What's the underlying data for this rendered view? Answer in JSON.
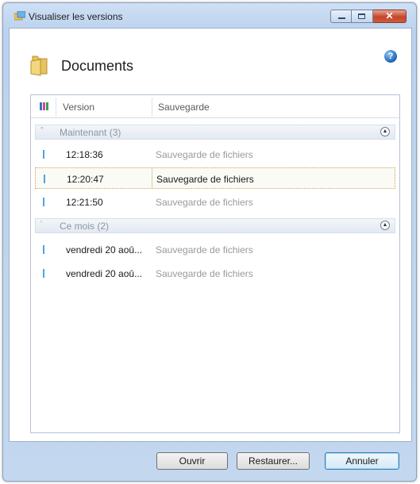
{
  "window": {
    "title": "Visualiser les versions",
    "close_glyph": "✕"
  },
  "header": {
    "title": "Documents",
    "help_glyph": "?"
  },
  "columns": {
    "version": "Version",
    "sauvegarde": "Sauvegarde"
  },
  "groups": [
    {
      "label": "Maintenant (3)",
      "collapse_glyph": "▲",
      "items": [
        {
          "version": "12:18:36",
          "sauvegarde": "Sauvegarde de fichiers",
          "selected": false
        },
        {
          "version": "12:20:47",
          "sauvegarde": "Sauvegarde de fichiers",
          "selected": true
        },
        {
          "version": "12:21:50",
          "sauvegarde": "Sauvegarde de fichiers",
          "selected": false
        }
      ]
    },
    {
      "label": "Ce mois (2)",
      "collapse_glyph": "▲",
      "items": [
        {
          "version": "vendredi 20 aoû...",
          "sauvegarde": "Sauvegarde de fichiers",
          "selected": false
        },
        {
          "version": "vendredi 20 aoû...",
          "sauvegarde": "Sauvegarde de fichiers",
          "selected": false
        }
      ]
    }
  ],
  "buttons": {
    "open": "Ouvrir",
    "restore": "Restaurer...",
    "cancel": "Annuler"
  },
  "colors": {
    "accent": "#3c7fb1",
    "row_marker": "#4aa7e0",
    "close_button": "#c6452a"
  }
}
